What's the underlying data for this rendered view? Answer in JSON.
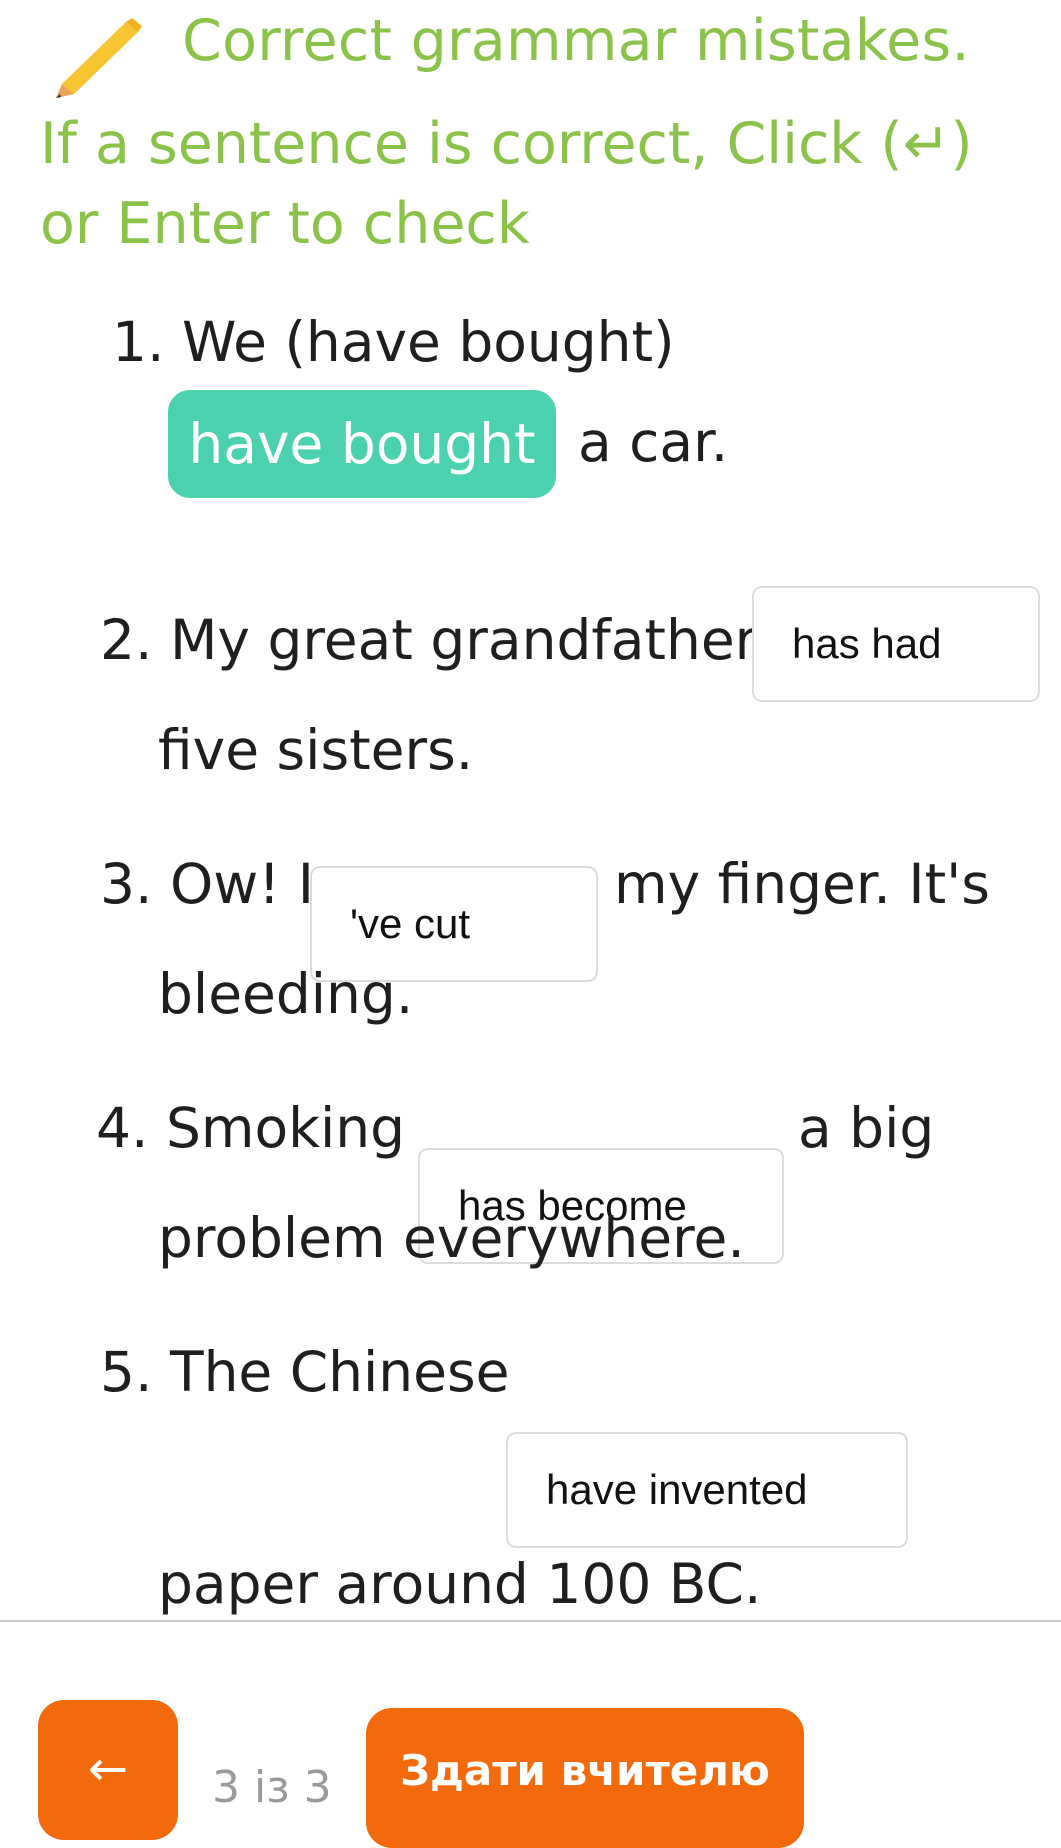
{
  "header": {
    "title": "Correct grammar mistakes.",
    "instruction": "If a sentence is correct, Click (↵) or Enter to check",
    "icon": "pencil-icon"
  },
  "questions": [
    {
      "number": "1.",
      "before": "We (have bought)",
      "answer": "have bought",
      "after": "a car."
    },
    {
      "number": "2.",
      "before": "My great grandfather",
      "answer": "has had",
      "after": "five sisters."
    },
    {
      "number": "3.",
      "before": "Ow! I",
      "answer": "'ve cut",
      "after": "my finger. It's",
      "after2": "bleeding."
    },
    {
      "number": "4.",
      "before": "Smoking",
      "answer": "has become",
      "after": "a big",
      "after2": "problem everywhere."
    },
    {
      "number": "5.",
      "before": "The Chinese",
      "answer": "have invented",
      "after": "paper around 100 BC."
    }
  ],
  "footer": {
    "back_label": "←",
    "page_indicator": "3 із 3",
    "submit_label": "Здати вчителю"
  },
  "colors": {
    "header_green": "#8ac24a",
    "answer_chip": "#4bd1ae",
    "accent_orange": "#f26a0b"
  }
}
